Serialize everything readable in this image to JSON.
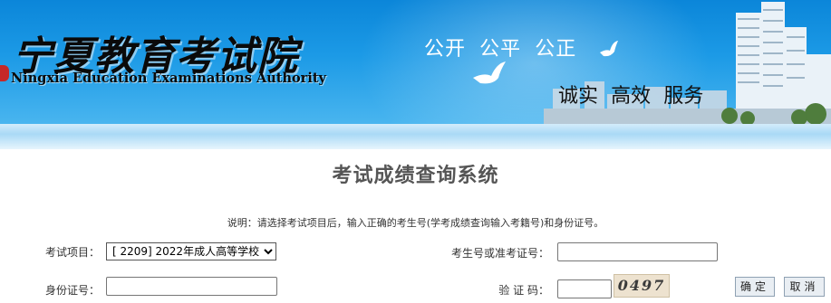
{
  "header": {
    "logo_cn": "宁夏教育考试院",
    "logo_en": "Ningxia Education Examinations Authority",
    "slogan_top": "公开  公平  公正",
    "slogan_bottom": "诚实  高效  服务"
  },
  "page": {
    "title": "考试成绩查询系统",
    "instruction": "说明：请选择考试项目后，输入正确的考生号(学考成绩查询输入考籍号)和身份证号。"
  },
  "form": {
    "exam_item_label": "考试项目：",
    "exam_item_selected": "[ 2209] 2022年成人高等学校",
    "candidate_no_label": "考生号或准考证号：",
    "candidate_no_value": "",
    "id_card_label": "身份证号：",
    "id_card_value": "",
    "captcha_label": "验 证 码：",
    "captcha_value": "",
    "captcha_image_text": "0497",
    "confirm_button": "确定",
    "cancel_button": "取消"
  },
  "colors": {
    "banner": "#1c9ae6",
    "title_text": "#555555",
    "button_bg": "#e9eef3"
  }
}
